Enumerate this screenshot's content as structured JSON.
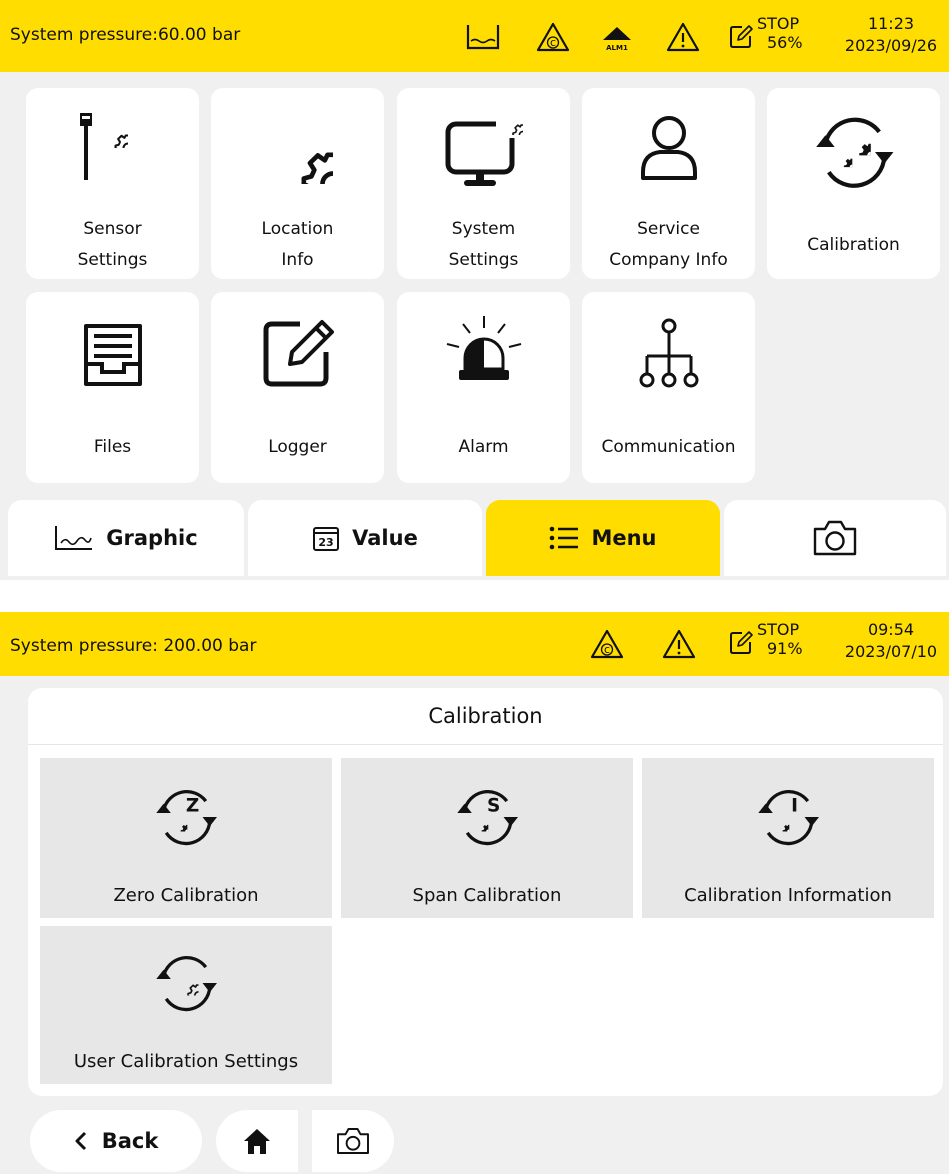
{
  "screen1": {
    "status": {
      "pressure": "System pressure:60.00 bar",
      "alarm_label": "ALM1",
      "stop_label": "STOP",
      "stop_percent": "56%",
      "time": "11:23",
      "date": "2023/09/26"
    },
    "tiles": [
      {
        "label": "Sensor\nSettings"
      },
      {
        "label": "Location\nInfo"
      },
      {
        "label": "System\nSettings"
      },
      {
        "label": "Service\nCompany Info"
      },
      {
        "label": "Calibration"
      },
      {
        "label": "Files"
      },
      {
        "label": "Logger"
      },
      {
        "label": "Alarm"
      },
      {
        "label": "Communication"
      }
    ],
    "tabs": {
      "graphic": "Graphic",
      "value": "Value",
      "value_icon_number": "23",
      "menu": "Menu"
    }
  },
  "screen2": {
    "status": {
      "pressure": "System pressure: 200.00 bar",
      "stop_label": "STOP",
      "stop_percent": "91%",
      "time": "09:54",
      "date": "2023/07/10"
    },
    "panel_title": "Calibration",
    "tiles": [
      {
        "label": "Zero Calibration",
        "badge": "Z"
      },
      {
        "label": "Span Calibration",
        "badge": "S"
      },
      {
        "label": "Calibration Information",
        "badge": "I"
      },
      {
        "label": "User Calibration Settings"
      }
    ],
    "back_label": "Back"
  },
  "colors": {
    "accent_yellow": "#ffdd00",
    "background": "#f0f0f0",
    "tile_white": "#ffffff",
    "tile_gray": "#e7e7e7",
    "icon_black": "#111111"
  }
}
